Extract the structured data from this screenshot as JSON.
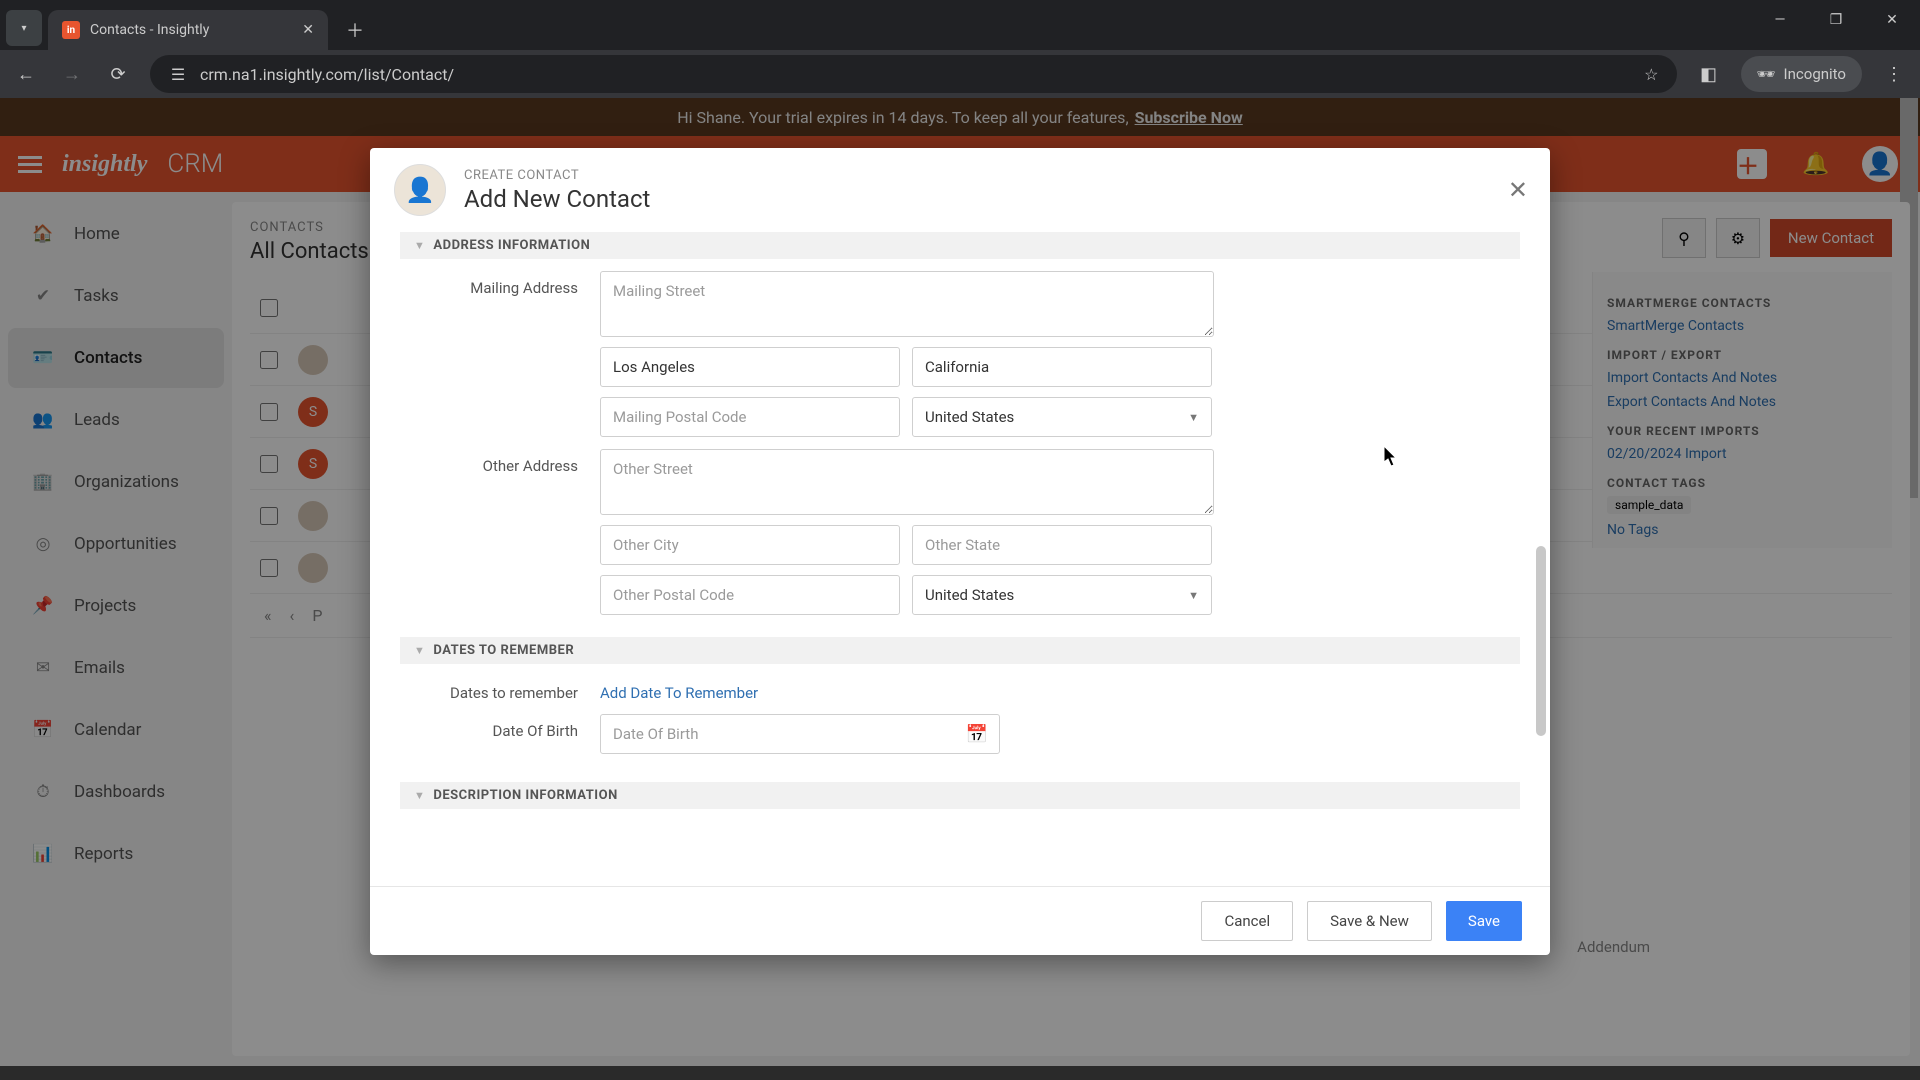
{
  "browser": {
    "tab_title": "Contacts - Insightly",
    "url": "crm.na1.insightly.com/list/Contact/",
    "incognito_label": "Incognito"
  },
  "trial": {
    "text_prefix": "Hi Shane. Your trial expires in 14 days. To keep all your features, ",
    "subscribe": "Subscribe Now"
  },
  "header": {
    "logo": "insightly",
    "product": "CRM"
  },
  "sidebar": {
    "items": [
      {
        "label": "Home"
      },
      {
        "label": "Tasks"
      },
      {
        "label": "Contacts"
      },
      {
        "label": "Leads"
      },
      {
        "label": "Organizations"
      },
      {
        "label": "Opportunities"
      },
      {
        "label": "Projects"
      },
      {
        "label": "Emails"
      },
      {
        "label": "Calendar"
      },
      {
        "label": "Dashboards"
      },
      {
        "label": "Reports"
      }
    ]
  },
  "main": {
    "crumb": "CONTACTS",
    "title": "All Contacts",
    "new_button": "New Contact",
    "pager_label": "P"
  },
  "right_panel": {
    "merge_head": "SMARTMERGE CONTACTS",
    "merge_link": "SmartMerge Contacts",
    "impexp_head": "IMPORT / EXPORT",
    "import_link": "Import Contacts And Notes",
    "export_link": "Export Contacts And Notes",
    "recent_head": "YOUR RECENT IMPORTS",
    "recent_link": "02/20/2024 Import",
    "tags_head": "CONTACT TAGS",
    "tag1": "sample_data",
    "no_tags": "No Tags"
  },
  "addendum": "Addendum",
  "modal": {
    "eyebrow": "CREATE CONTACT",
    "title": "Add New Contact",
    "section_address": "ADDRESS INFORMATION",
    "section_dates": "DATES TO REMEMBER",
    "section_desc": "DESCRIPTION INFORMATION",
    "mailing_label": "Mailing Address",
    "mailing_street_ph": "Mailing Street",
    "mailing_city_val": "Los Angeles",
    "mailing_state_val": "California",
    "mailing_postal_ph": "Mailing Postal Code",
    "mailing_country": "United States",
    "other_label": "Other Address",
    "other_street_ph": "Other Street",
    "other_city_ph": "Other City",
    "other_state_ph": "Other State",
    "other_postal_ph": "Other Postal Code",
    "other_country": "United States",
    "dates_label": "Dates to remember",
    "add_date_link": "Add Date To Remember",
    "dob_label": "Date Of Birth",
    "dob_ph": "Date Of Birth",
    "cancel": "Cancel",
    "save_new": "Save & New",
    "save": "Save"
  }
}
